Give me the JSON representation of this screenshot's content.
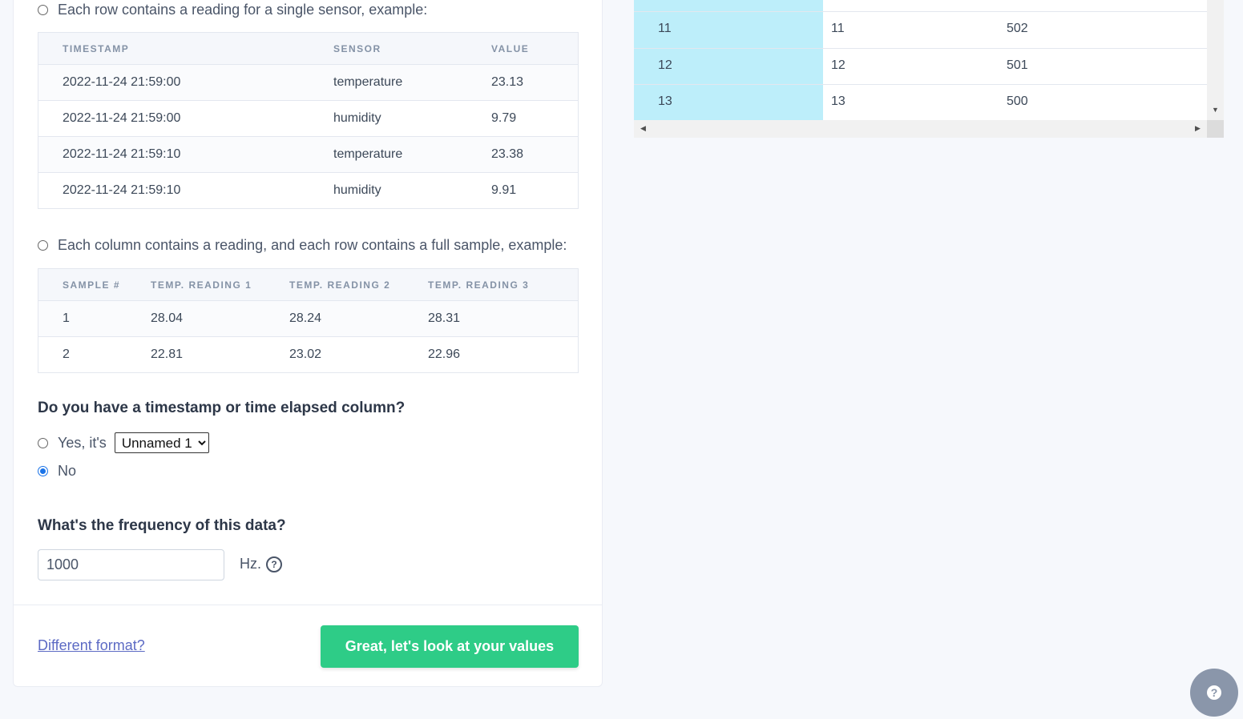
{
  "option1": {
    "label": "Each row contains a reading for a single sensor, example:"
  },
  "table1": {
    "headers": [
      "TIMESTAMP",
      "SENSOR",
      "VALUE"
    ],
    "rows": [
      [
        "2022-11-24 21:59:00",
        "temperature",
        "23.13"
      ],
      [
        "2022-11-24 21:59:00",
        "humidity",
        "9.79"
      ],
      [
        "2022-11-24 21:59:10",
        "temperature",
        "23.38"
      ],
      [
        "2022-11-24 21:59:10",
        "humidity",
        "9.91"
      ]
    ]
  },
  "option2": {
    "label": "Each column contains a reading, and each row contains a full sample, example:"
  },
  "table2": {
    "headers": [
      "SAMPLE #",
      "TEMP. READING 1",
      "TEMP. READING 2",
      "TEMP. READING 3"
    ],
    "rows": [
      [
        "1",
        "28.04",
        "28.24",
        "28.31"
      ],
      [
        "2",
        "22.81",
        "23.02",
        "22.96"
      ]
    ]
  },
  "timestamp_q": {
    "title": "Do you have a timestamp or time elapsed column?",
    "yes_label": "Yes, it's",
    "select_value": "Unnamed 1",
    "no_label": "No"
  },
  "frequency_q": {
    "title": "What's the frequency of this data?",
    "value": "1000",
    "unit": "Hz."
  },
  "footer": {
    "link": "Different format?",
    "button": "Great, let's look at your values"
  },
  "grid": {
    "rows": [
      [
        "11",
        "11",
        "502"
      ],
      [
        "12",
        "12",
        "501"
      ],
      [
        "13",
        "13",
        "500"
      ]
    ]
  }
}
